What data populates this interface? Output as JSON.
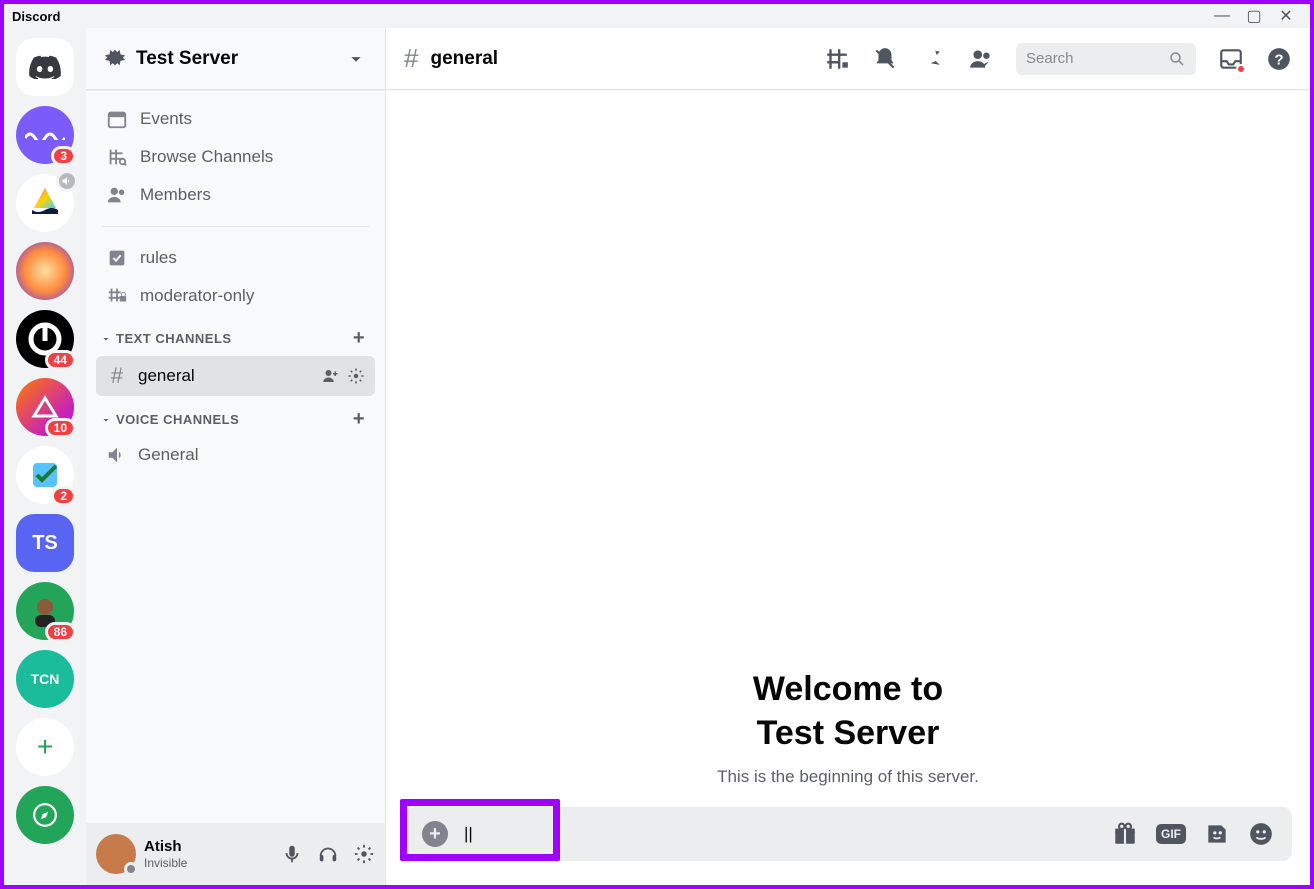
{
  "titlebar": {
    "title": "Discord"
  },
  "servers": [
    {
      "name": "discord-home",
      "badge": null,
      "type": "home"
    },
    {
      "name": "server-purple",
      "badge": "3",
      "type": "purple"
    },
    {
      "name": "server-sail",
      "badge": null,
      "type": "sail",
      "muted": true
    },
    {
      "name": "server-face",
      "badge": null,
      "type": "face"
    },
    {
      "name": "server-p",
      "badge": "44",
      "type": "black-p"
    },
    {
      "name": "server-grad",
      "badge": "10",
      "type": "grad"
    },
    {
      "name": "server-check",
      "badge": "2",
      "type": "check"
    },
    {
      "name": "server-ts",
      "badge": null,
      "type": "ts",
      "label": "TS"
    },
    {
      "name": "server-green-av",
      "badge": "86",
      "type": "greenav"
    },
    {
      "name": "server-tcn",
      "badge": null,
      "type": "teal",
      "label": "TCN"
    }
  ],
  "server_header": {
    "name": "Test Server"
  },
  "sidebar": {
    "top_items": [
      {
        "icon": "calendar",
        "label": "Events"
      },
      {
        "icon": "browse",
        "label": "Browse Channels"
      },
      {
        "icon": "members",
        "label": "Members"
      }
    ],
    "pinned": [
      {
        "icon": "rules",
        "label": "rules"
      },
      {
        "icon": "hash-lock",
        "label": "moderator-only"
      }
    ],
    "categories": [
      {
        "name": "TEXT CHANNELS",
        "channels": [
          {
            "name": "general",
            "selected": true
          }
        ]
      },
      {
        "name": "VOICE CHANNELS",
        "channels": [
          {
            "name": "General",
            "voice": true
          }
        ]
      }
    ]
  },
  "user_panel": {
    "name": "Atish",
    "status": "Invisible"
  },
  "channel_header": {
    "name": "general",
    "search_placeholder": "Search"
  },
  "welcome": {
    "line1": "Welcome to",
    "line2": "Test Server",
    "sub": "This is the beginning of this server."
  },
  "composer": {
    "value": "||"
  }
}
